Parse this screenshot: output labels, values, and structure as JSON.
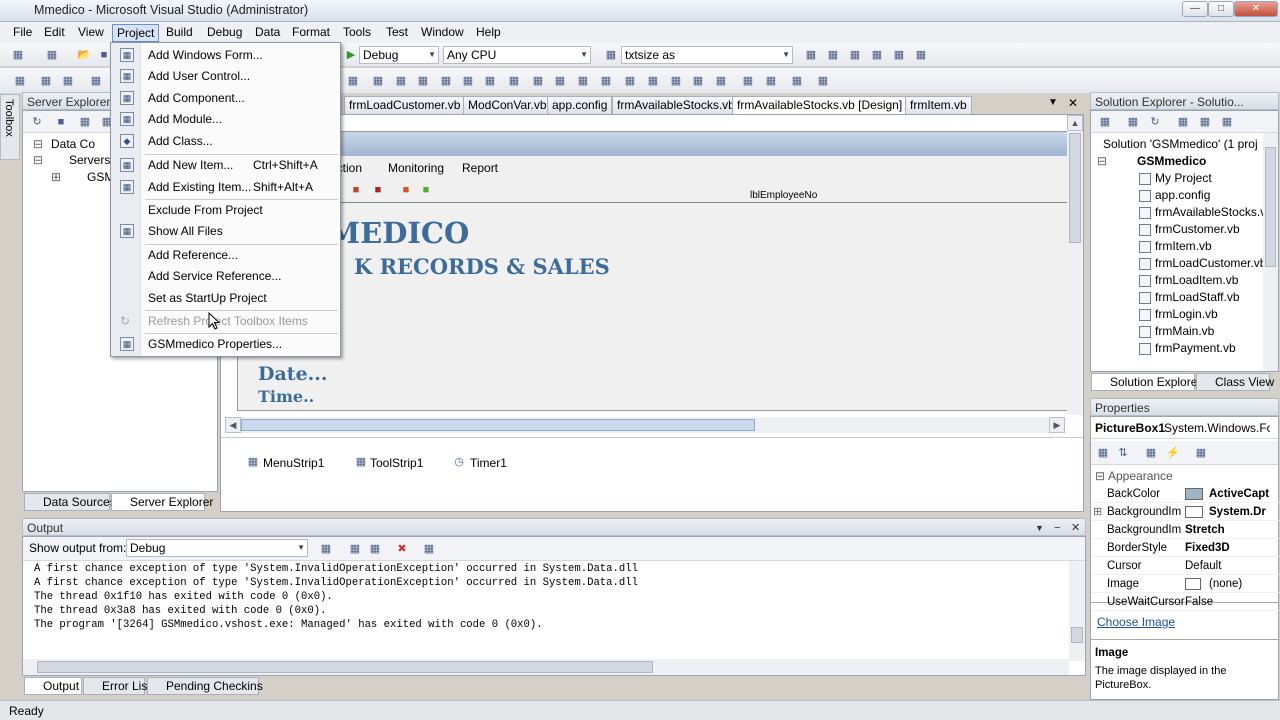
{
  "window": {
    "title": "Mmedico - Microsoft Visual Studio (Administrator)"
  },
  "menubar": [
    "File",
    "Edit",
    "View",
    "Project",
    "Build",
    "Debug",
    "Data",
    "Format",
    "Tools",
    "Test",
    "Window",
    "Help"
  ],
  "toolbar": {
    "config": "Debug",
    "platform": "Any CPU",
    "find": "txtsize as"
  },
  "project_menu": [
    {
      "label": "Add Windows Form...",
      "shortcut": ""
    },
    {
      "label": "Add User Control...",
      "shortcut": ""
    },
    {
      "label": "Add Component...",
      "shortcut": ""
    },
    {
      "label": "Add Module...",
      "shortcut": ""
    },
    {
      "label": "Add Class...",
      "shortcut": ""
    },
    {
      "label": "Add New Item...",
      "shortcut": "Ctrl+Shift+A"
    },
    {
      "label": "Add Existing Item...",
      "shortcut": "Shift+Alt+A"
    },
    {
      "label": "Exclude From Project",
      "shortcut": ""
    },
    {
      "label": "Show All Files",
      "shortcut": ""
    },
    {
      "label": "Add Reference...",
      "shortcut": ""
    },
    {
      "label": "Add Service Reference...",
      "shortcut": ""
    },
    {
      "label": "Set as StartUp Project",
      "shortcut": ""
    },
    {
      "label": "Refresh Project Toolbox Items",
      "shortcut": ""
    },
    {
      "label": "GSMmedico Properties...",
      "shortcut": ""
    }
  ],
  "server_explorer": {
    "title": "Server Explorer",
    "nodes": [
      "Data Co",
      "Servers",
      "GSM"
    ],
    "tabs": [
      "Data Sources",
      "Server Explorer"
    ]
  },
  "toolbox_label": "Toolbox",
  "doc_tabs": [
    "frmLoadCustomer.vb",
    "ModConVar.vb",
    "app.config",
    "frmAvailableStocks.vb",
    "frmAvailableStocks.vb [Design]",
    "frmItem.vb"
  ],
  "designer": {
    "menu": [
      "action",
      "Monitoring",
      "Report"
    ],
    "label_emp": "lblEmployeeNo",
    "heading1": "MEDICO",
    "heading2": "K RECORDS & SALES",
    "date": "Date...",
    "time": "Time..",
    "tray": [
      "MenuStrip1",
      "ToolStrip1",
      "Timer1"
    ]
  },
  "solution_explorer": {
    "title": "Solution Explorer - Solutio...",
    "solution": "Solution 'GSMmedico' (1 proj",
    "project": "GSMmedico",
    "items": [
      "My Project",
      "app.config",
      "frmAvailableStocks.vb",
      "frmCustomer.vb",
      "frmItem.vb",
      "frmLoadCustomer.vb",
      "frmLoadItem.vb",
      "frmLoadStaff.vb",
      "frmLogin.vb",
      "frmMain.vb",
      "frmPayment.vb"
    ],
    "tabs": [
      "Solution Explorer",
      "Class View"
    ]
  },
  "properties": {
    "title": "Properties",
    "object": "PictureBox1",
    "object_type": "System.Windows.For",
    "category": "Appearance",
    "rows": [
      {
        "name": "BackColor",
        "value": "ActiveCapt"
      },
      {
        "name": "BackgroundIm",
        "value": "System.Dr"
      },
      {
        "name": "BackgroundIm",
        "value": "Stretch"
      },
      {
        "name": "BorderStyle",
        "value": "Fixed3D"
      },
      {
        "name": "Cursor",
        "value": "Default"
      },
      {
        "name": "Image",
        "value": "(none)"
      },
      {
        "name": "UseWaitCursor",
        "value": "False"
      }
    ],
    "link": "Choose Image",
    "desc_title": "Image",
    "desc_text": "The image displayed in the PictureBox."
  },
  "output": {
    "title": "Output",
    "show_from_label": "Show output from:",
    "show_from": "Debug",
    "lines": [
      "A first chance exception of type 'System.InvalidOperationException' occurred in System.Data.dll",
      "A first chance exception of type 'System.InvalidOperationException' occurred in System.Data.dll",
      "The thread 0x1f10 has exited with code 0 (0x0).",
      "The thread 0x3a8 has exited with code 0 (0x0).",
      "The program '[3264] GSMmedico.vshost.exe: Managed' has exited with code 0 (0x0)."
    ],
    "tabs": [
      "Output",
      "Error List",
      "Pending Checkins"
    ]
  },
  "status": "Ready",
  "colors": {
    "accent": "#3d6b9a",
    "menu_hl": "#d7e3f6"
  }
}
